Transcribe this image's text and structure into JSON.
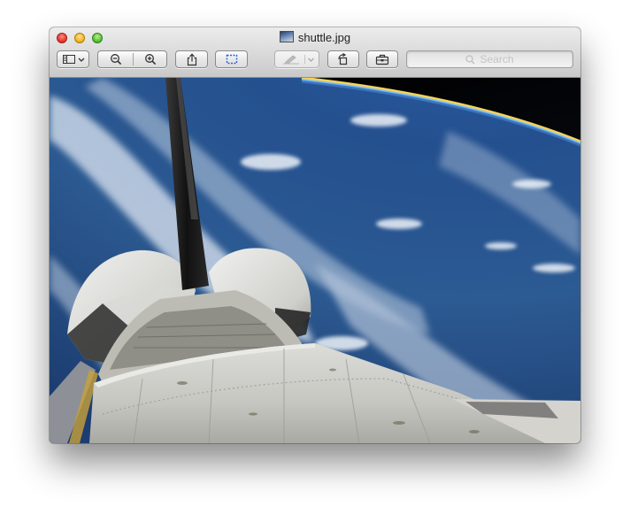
{
  "window": {
    "title": "shuttle.jpg"
  },
  "toolbar": {
    "buttons": [
      {
        "name": "sidebar-view",
        "icon": "sidebar-icon"
      },
      {
        "name": "zoom-out",
        "icon": "zoom-out-icon"
      },
      {
        "name": "zoom-in",
        "icon": "zoom-in-icon"
      },
      {
        "name": "share",
        "icon": "share-icon"
      },
      {
        "name": "selection",
        "icon": "rect-select-icon"
      },
      {
        "name": "annotate",
        "icon": "pen-icon"
      },
      {
        "name": "rotate",
        "icon": "rotate-icon"
      },
      {
        "name": "toolbox",
        "icon": "toolbox-icon"
      }
    ],
    "search_placeholder": "Search"
  },
  "image": {
    "file": "shuttle.jpg",
    "subject": "space shuttle orbiter over Earth"
  }
}
